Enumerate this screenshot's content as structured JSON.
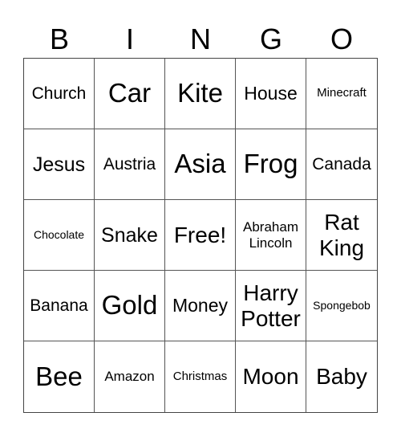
{
  "header": [
    "B",
    "I",
    "N",
    "G",
    "O"
  ],
  "cells": [
    {
      "label": "Church",
      "size": "s20"
    },
    {
      "label": "Car",
      "size": "s32"
    },
    {
      "label": "Kite",
      "size": "s32"
    },
    {
      "label": "House",
      "size": "s22"
    },
    {
      "label": "Minecraft",
      "size": "s15"
    },
    {
      "label": "Jesus",
      "size": "s24"
    },
    {
      "label": "Austria",
      "size": "s20"
    },
    {
      "label": "Asia",
      "size": "s32"
    },
    {
      "label": "Frog",
      "size": "s32"
    },
    {
      "label": "Canada",
      "size": "s20"
    },
    {
      "label": "Chocolate",
      "size": "s14"
    },
    {
      "label": "Snake",
      "size": "s24"
    },
    {
      "label": "Free!",
      "size": "s27"
    },
    {
      "label": "Abraham Lincoln",
      "size": "s17"
    },
    {
      "label": "Rat King",
      "size": "s27"
    },
    {
      "label": "Banana",
      "size": "s20"
    },
    {
      "label": "Gold",
      "size": "s32"
    },
    {
      "label": "Money",
      "size": "s22"
    },
    {
      "label": "Harry Potter",
      "size": "s27"
    },
    {
      "label": "Spongebob",
      "size": "s14"
    },
    {
      "label": "Bee",
      "size": "s32"
    },
    {
      "label": "Amazon",
      "size": "s17"
    },
    {
      "label": "Christmas",
      "size": "s15"
    },
    {
      "label": "Moon",
      "size": "s27"
    },
    {
      "label": "Baby",
      "size": "s27"
    }
  ]
}
